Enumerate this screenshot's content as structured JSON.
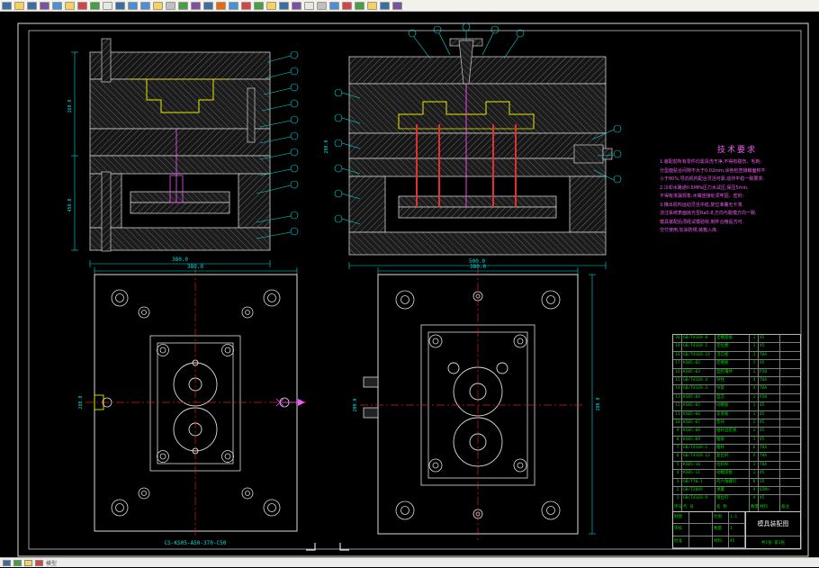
{
  "toolbar": {
    "icons": [
      {
        "n": "new-icon",
        "c": "#3a6ea5"
      },
      {
        "n": "open-icon",
        "c": "#f7d25a"
      },
      {
        "n": "save-icon",
        "c": "#3a6ea5"
      },
      {
        "n": "plot-icon",
        "c": "#7a52a0"
      },
      {
        "n": "preview-icon",
        "c": "#4a90d9"
      },
      {
        "n": "find-icon",
        "c": "#f7d25a"
      },
      {
        "n": "cut-icon",
        "c": "#d04545"
      },
      {
        "n": "copy-icon",
        "c": "#45a045"
      },
      {
        "n": "paste-icon",
        "c": "#e8e8e8"
      },
      {
        "n": "match-properties-icon",
        "c": "#3a6ea5"
      },
      {
        "n": "undo-icon",
        "c": "#4a90d9"
      },
      {
        "n": "redo-icon",
        "c": "#4a90d9"
      },
      {
        "n": "pan-icon",
        "c": "#f7d25a"
      },
      {
        "n": "zoom-realtime-icon",
        "c": "#c0c0c0"
      },
      {
        "n": "zoom-window-icon",
        "c": "#45a045"
      },
      {
        "n": "zoom-previous-icon",
        "c": "#7a52a0"
      },
      {
        "n": "properties-icon",
        "c": "#3a6ea5"
      },
      {
        "n": "designcenter-icon",
        "c": "#e86a10"
      },
      {
        "n": "toolpalettes-icon",
        "c": "#4a90d9"
      },
      {
        "n": "sheetset-icon",
        "c": "#d04545"
      },
      {
        "n": "markup-icon",
        "c": "#45a045"
      },
      {
        "n": "block-editor-icon",
        "c": "#f7d25a"
      },
      {
        "n": "layer-icon",
        "c": "#3a6ea5"
      },
      {
        "n": "layer-states-icon",
        "c": "#7a52a0"
      },
      {
        "n": "color-control-icon",
        "c": "#e8e8e8"
      },
      {
        "n": "linetype-icon",
        "c": "#c0c0c0"
      },
      {
        "n": "lineweight-icon",
        "c": "#4a90d9"
      },
      {
        "n": "text-style-icon",
        "c": "#d04545"
      },
      {
        "n": "dim-style-icon",
        "c": "#45a045"
      },
      {
        "n": "table-style-icon",
        "c": "#f7d25a"
      },
      {
        "n": "workspace-icon",
        "c": "#3a6ea5"
      },
      {
        "n": "help-icon",
        "c": "#7a52a0"
      }
    ]
  },
  "tech": {
    "title": "技术要求",
    "lines": [
      "1.装配前所有零件均需清洗干净,不得有碰伤、毛刺;",
      "分型面贴合间隙不大于0.02mm,涂色检查接触面积不",
      "小于80%,导向机构配合灵活可靠,动作平稳一致要求;",
      "2.冷却水路通0.5MPa压力水试压,保压5min,",
      "不得有渗漏现象,水嘴连接处须牢固、密封;",
      "3.推出机构运动灵活平稳,复位准确无卡滞,",
      "浇注系统表面抛光至Ra0.8,方向与脱模方向一致,",
      "模具装配后须经试模验收,制件合格后方可,",
      "交付使用,加油防锈,装箱入库."
    ]
  },
  "dims": {
    "sec_left_width": "380.0",
    "sec_left_h": "450.0",
    "sec_left_h2": "160.0",
    "sec_right_width": "500.0",
    "sec_right_h": "200.0",
    "plan_left_width": "380.0",
    "plan_left_height": "280.0",
    "plan_right_width": "380.0",
    "plan_right_height": "200.0",
    "plan_right_side": "280.0"
  },
  "drawing_number": "CS-KS05-A50-370-C50",
  "bom": {
    "headers": [
      "序号",
      "代  号",
      "名  称",
      "数量",
      "材料",
      "备注"
    ],
    "rows": [
      {
        "seq": "20",
        "code": "GB/T4169.8",
        "name": "定模座板",
        "qty": "1",
        "mat": "45",
        "note": ""
      },
      {
        "seq": "19",
        "code": "GB/T4169.1",
        "name": "定位圈",
        "qty": "1",
        "mat": "45",
        "note": ""
      },
      {
        "seq": "18",
        "code": "GB/T4169.19",
        "name": "浇口套",
        "qty": "1",
        "mat": "T8A",
        "note": ""
      },
      {
        "seq": "17",
        "code": "KS05-02",
        "name": "定模板",
        "qty": "1",
        "mat": "45",
        "note": ""
      },
      {
        "seq": "16",
        "code": "KS05-03",
        "name": "型腔镶件",
        "qty": "1",
        "mat": "P20",
        "note": ""
      },
      {
        "seq": "15",
        "code": "GB/T4169.4",
        "name": "导柱",
        "qty": "4",
        "mat": "T8A",
        "note": ""
      },
      {
        "seq": "14",
        "code": "GB/T4169.3",
        "name": "导套",
        "qty": "4",
        "mat": "T8A",
        "note": ""
      },
      {
        "seq": "13",
        "code": "KS05-04",
        "name": "型芯",
        "qty": "1",
        "mat": "P20",
        "note": ""
      },
      {
        "seq": "12",
        "code": "KS05-05",
        "name": "动模板",
        "qty": "1",
        "mat": "45",
        "note": ""
      },
      {
        "seq": "11",
        "code": "KS05-06",
        "name": "支承板",
        "qty": "1",
        "mat": "45",
        "note": ""
      },
      {
        "seq": "10",
        "code": "KS05-07",
        "name": "垫块",
        "qty": "2",
        "mat": "45",
        "note": ""
      },
      {
        "seq": "9",
        "code": "KS05-08",
        "name": "推杆固定板",
        "qty": "1",
        "mat": "45",
        "note": ""
      },
      {
        "seq": "8",
        "code": "KS05-09",
        "name": "推板",
        "qty": "1",
        "mat": "45",
        "note": ""
      },
      {
        "seq": "7",
        "code": "GB/T4169.2",
        "name": "推杆",
        "qty": "6",
        "mat": "T8A",
        "note": ""
      },
      {
        "seq": "6",
        "code": "GB/T4169.13",
        "name": "复位杆",
        "qty": "4",
        "mat": "T8A",
        "note": ""
      },
      {
        "seq": "5",
        "code": "KS05-10",
        "name": "拉料杆",
        "qty": "1",
        "mat": "T8A",
        "note": ""
      },
      {
        "seq": "4",
        "code": "KS05-11",
        "name": "动模座板",
        "qty": "1",
        "mat": "45",
        "note": ""
      },
      {
        "seq": "3",
        "code": "GB/T70.1",
        "name": "内六角螺钉",
        "qty": "8",
        "mat": "35",
        "note": ""
      },
      {
        "seq": "2",
        "code": "GB/T2089",
        "name": "弹簧",
        "qty": "4",
        "mat": "65Mn",
        "note": ""
      },
      {
        "seq": "1",
        "code": "GB/T4169.9",
        "name": "限位钉",
        "qty": "4",
        "mat": "45",
        "note": ""
      }
    ]
  },
  "title_block": {
    "label_draw": "制图",
    "label_check": "审核",
    "label_appr": "批准",
    "label_scale": "比例",
    "label_qty": "数量",
    "label_mat": "材料",
    "scale": "1:1",
    "qty": "1",
    "mat": "45",
    "name": "模具装配图",
    "sheet": "共1张 第1张"
  },
  "statusbar": {
    "text": "模型"
  }
}
